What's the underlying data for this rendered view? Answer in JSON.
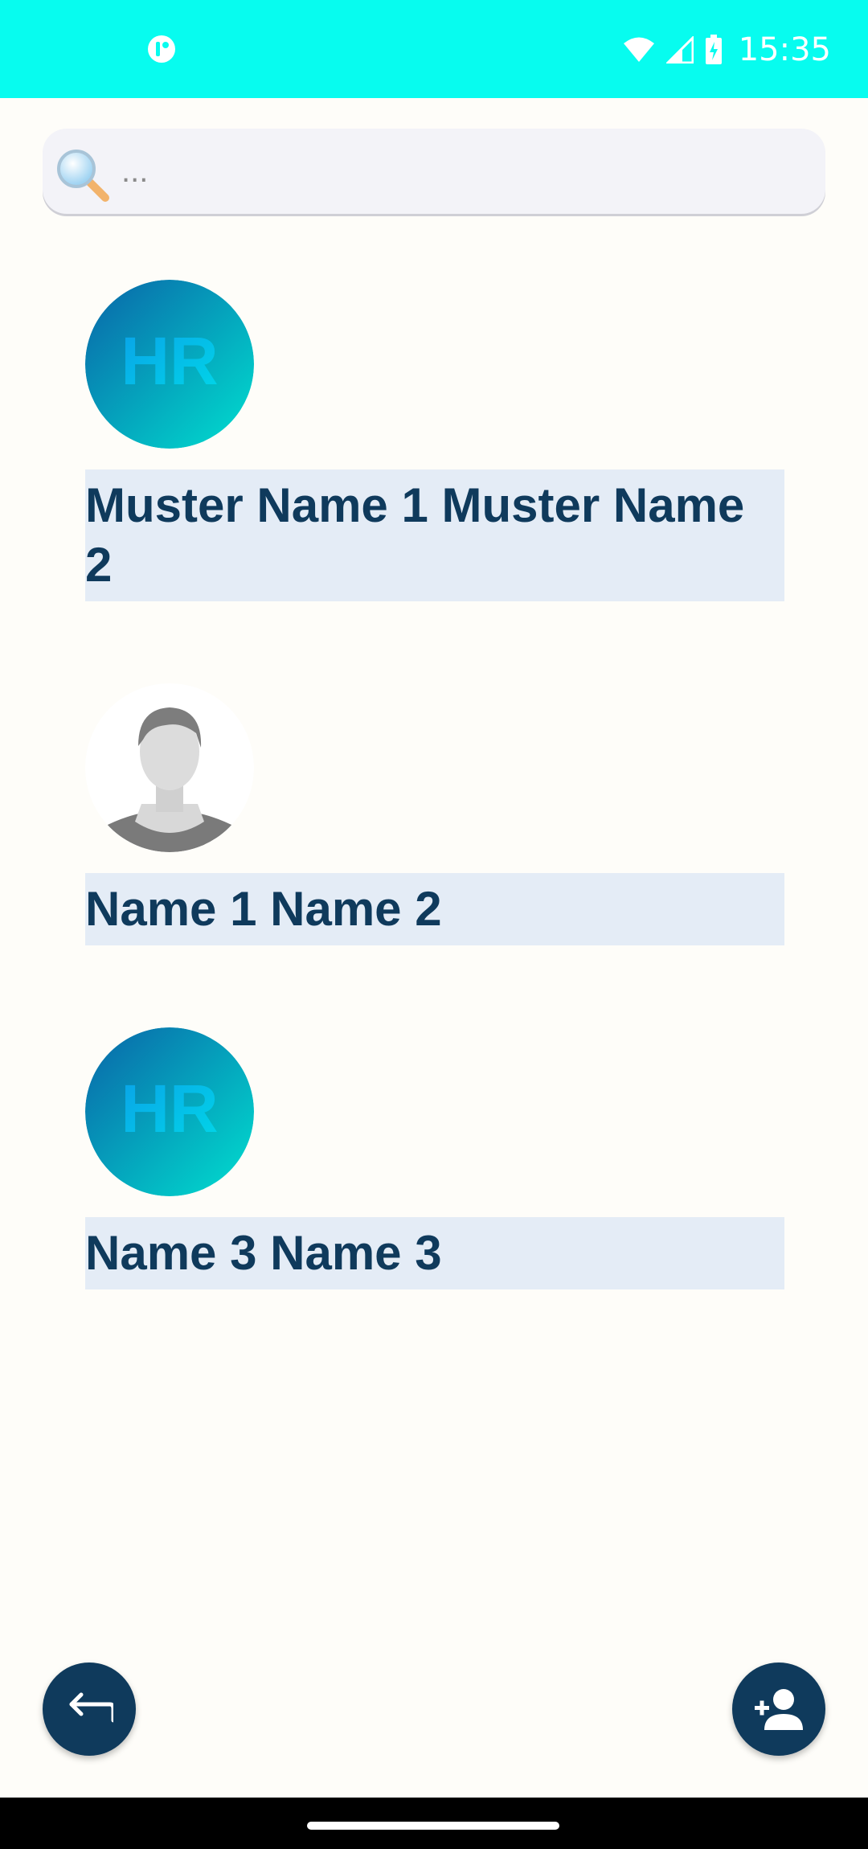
{
  "status_bar": {
    "time": "15:35",
    "background": "#07fcef",
    "icons": [
      "app-notification-icon",
      "wifi-icon",
      "cellular-signal-icon",
      "battery-charging-icon"
    ]
  },
  "search": {
    "value": "",
    "placeholder": "...",
    "icon": "magnifier-icon"
  },
  "contacts": [
    {
      "name": "Muster Name 1 Muster Name 2",
      "avatar": "hr-logo"
    },
    {
      "name": "Name 1 Name 2",
      "avatar": "default-person"
    },
    {
      "name": "Name 3 Name 3",
      "avatar": "hr-logo"
    }
  ],
  "avatar_logo_text": "HR",
  "actions": {
    "back_icon": "back-arrow-icon",
    "add_icon": "add-person-icon"
  },
  "colors": {
    "primary": "#0f3a5c",
    "name_highlight": "#e4ecf6",
    "background": "#fefdf9"
  }
}
